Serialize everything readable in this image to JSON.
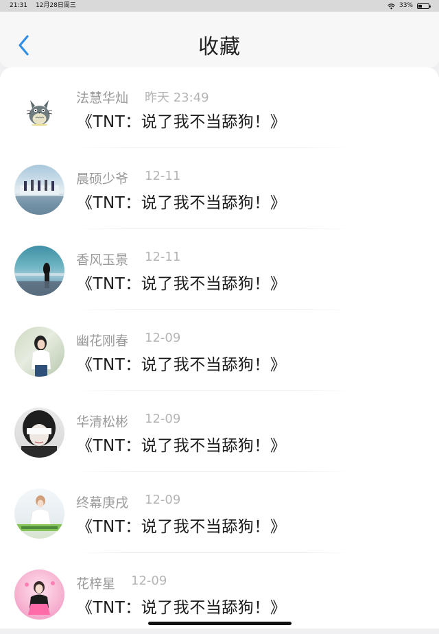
{
  "status_bar": {
    "time": "21:31",
    "date": "12月28日周三",
    "battery": "33%",
    "battery_level": 0.33
  },
  "header": {
    "title": "收藏",
    "back_icon": "chevron-left-icon",
    "accent_color": "#2f8fe6"
  },
  "favorites": [
    {
      "name": "法慧华灿",
      "time": "昨天 23:49",
      "message": "《TNT：说了我不当舔狗！》",
      "avatar_icon": "totoro-avatar"
    },
    {
      "name": "晨硕少爷",
      "time": "12-11",
      "message": "《TNT：说了我不当舔狗！》",
      "avatar_icon": "photo-avatar"
    },
    {
      "name": "香风玉景",
      "time": "12-11",
      "message": "《TNT：说了我不当舔狗！》",
      "avatar_icon": "photo-avatar"
    },
    {
      "name": "幽花刚春",
      "time": "12-09",
      "message": "《TNT：说了我不当舔狗！》",
      "avatar_icon": "photo-avatar"
    },
    {
      "name": "华清松彬",
      "time": "12-09",
      "message": "《TNT：说了我不当舔狗！》",
      "avatar_icon": "photo-avatar"
    },
    {
      "name": "终幕庚戌",
      "time": "12-09",
      "message": "《TNT：说了我不当舔狗！》",
      "avatar_icon": "photo-avatar"
    },
    {
      "name": "花梓星",
      "time": "12-09",
      "message": "《TNT：说了我不当舔狗！》",
      "avatar_icon": "photo-avatar"
    }
  ]
}
